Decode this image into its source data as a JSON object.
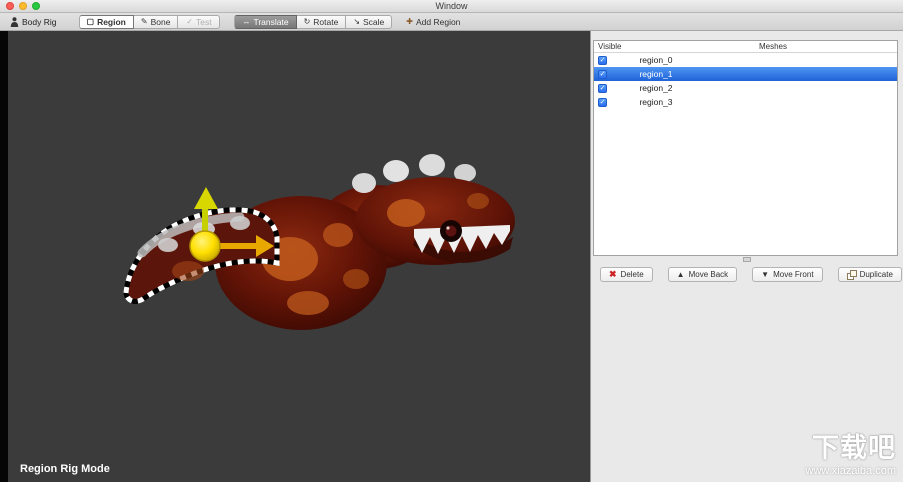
{
  "window": {
    "title": "Window"
  },
  "toolbar": {
    "body_rig_label": "Body Rig",
    "buttons": [
      {
        "label": "Region"
      },
      {
        "label": "Bone"
      },
      {
        "label": "Test"
      },
      {
        "label": "Translate"
      },
      {
        "label": "Rotate"
      },
      {
        "label": "Scale"
      }
    ],
    "add_region_label": "Add Region"
  },
  "icons": {
    "check": "✓",
    "region": "▢",
    "bone": "✎",
    "test": "✓",
    "translate": "↔",
    "rotate": "↻",
    "scale": "↘",
    "add_region": "✚",
    "delete": "✖",
    "move_back": "▲",
    "move_front": "▼"
  },
  "canvas": {
    "mode_label": "Region Rig Mode"
  },
  "panel": {
    "columns": [
      "Visible",
      "Meshes"
    ],
    "rows": [
      {
        "name": "region_0",
        "visible": true,
        "selected": false
      },
      {
        "name": "region_1",
        "visible": true,
        "selected": true
      },
      {
        "name": "region_2",
        "visible": true,
        "selected": false
      },
      {
        "name": "region_3",
        "visible": true,
        "selected": false
      }
    ],
    "actions": [
      "Delete",
      "Move Back",
      "Move Front",
      "Duplicate"
    ]
  },
  "watermark": {
    "title": "下载吧",
    "url": "www.xiazaiba.com"
  },
  "colors": {
    "selection_blue": "#2f72e4",
    "checkbox_blue": "#3478f6",
    "canvas_bg": "#3b3b3b",
    "delete_red": "#cc2222",
    "gizmo_yellow": "#ffe000",
    "gizmo_green": "#c6cf00",
    "gizmo_orange": "#e8a800"
  }
}
